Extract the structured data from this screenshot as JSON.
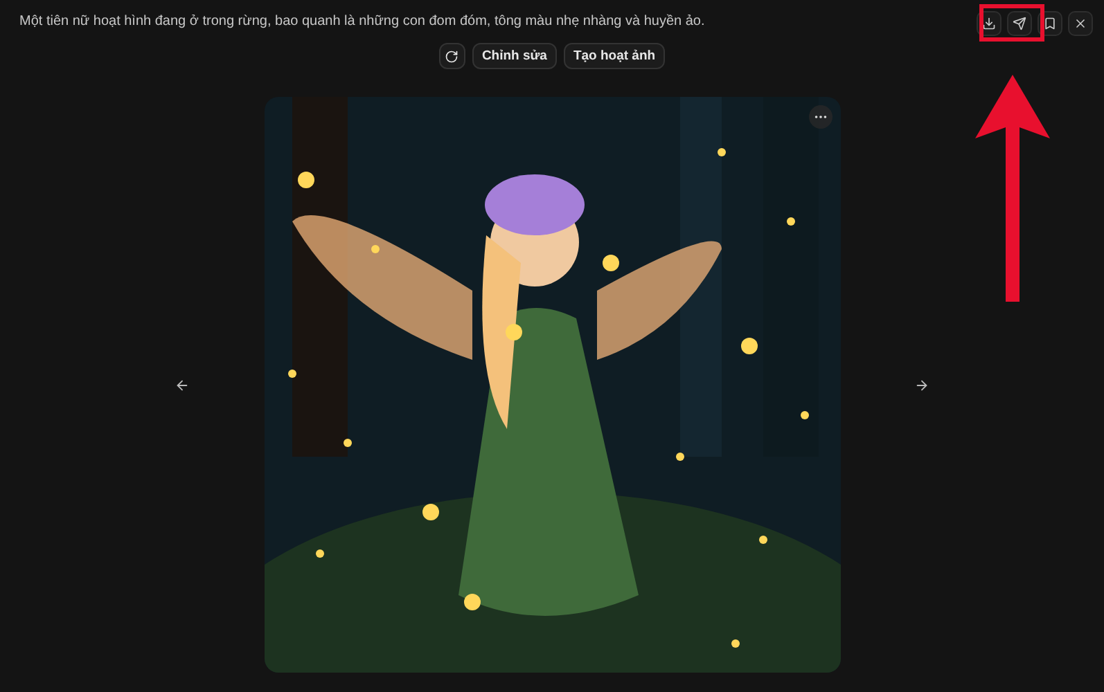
{
  "prompt": "Một tiên nữ hoạt hình đang ở trong rừng, bao quanh là những con đom đóm, tông màu nhẹ nhàng và huyền ảo.",
  "actions": [
    "Chỉnh sửa",
    "Tạo hoạt ảnh"
  ]
}
